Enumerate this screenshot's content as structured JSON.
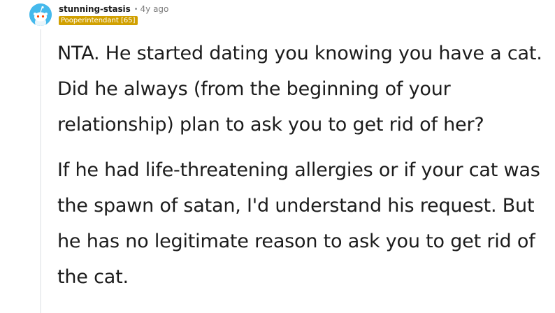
{
  "comment": {
    "author": "stunning-stasis",
    "separator": "•",
    "timestamp": "4y ago",
    "flair": "Pooperintendant [65]",
    "paragraphs": [
      "NTA. He started dating you knowing you have a cat. Did he always (from the beginning of your relationship) plan to ask you to get rid of her?",
      "If he had life-threatening allergies or if your cat was the spawn of satan, I'd understand his request. But he has no legitimate reason to ask you to get rid of the cat."
    ]
  },
  "colors": {
    "avatar_background": "#45b9ec",
    "flair_background": "#d1a000",
    "thread_line": "#edeff1",
    "text": "#1c1c1c"
  },
  "icons": {
    "avatar": "snoo-avatar-icon"
  }
}
